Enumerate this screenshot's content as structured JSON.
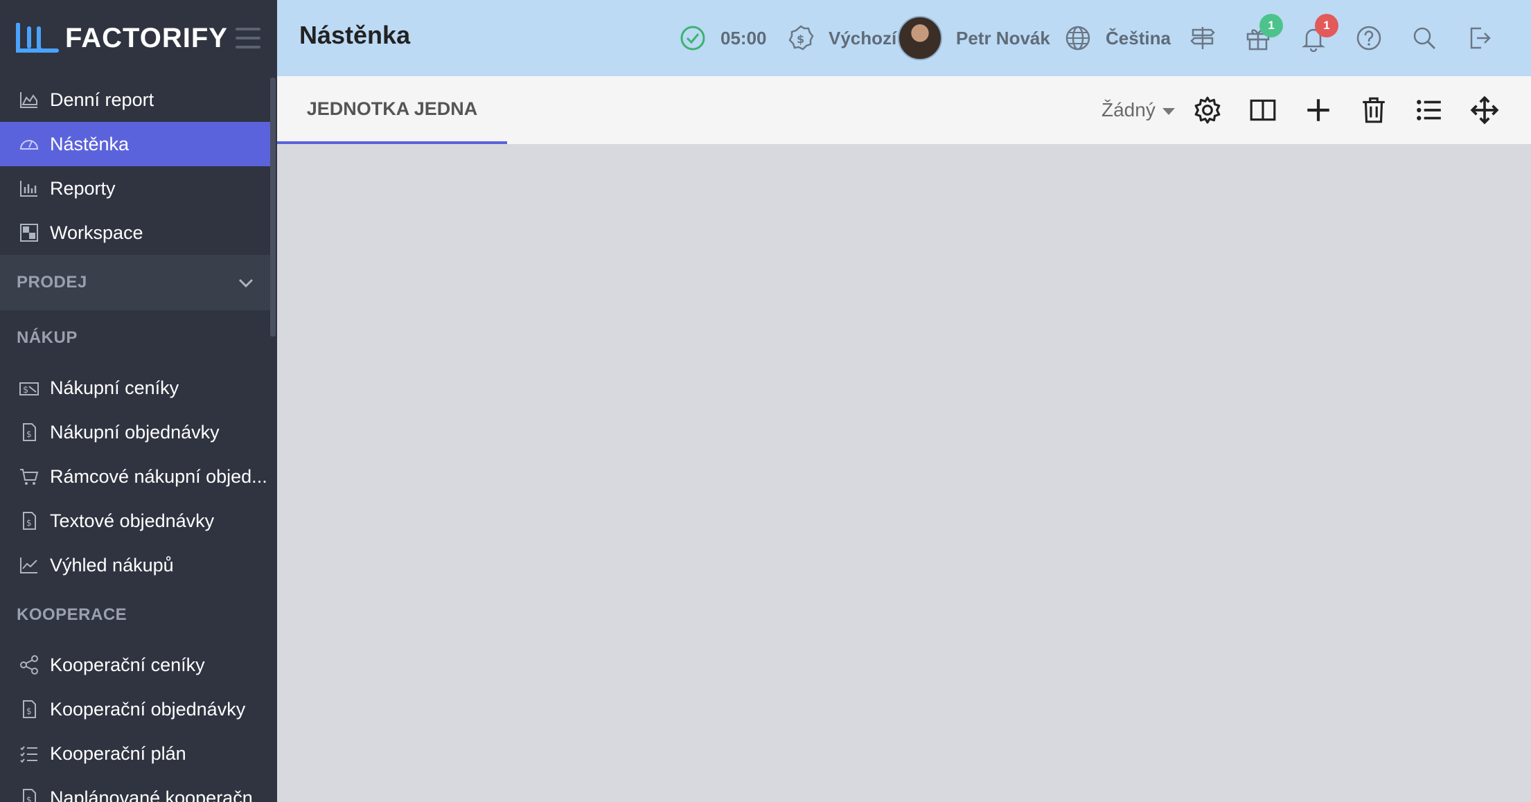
{
  "brand": {
    "name": "FACTORIFY"
  },
  "sidebar": {
    "top_items": [
      {
        "label": "Denní report",
        "icon": "area-chart-icon"
      },
      {
        "label": "Nástěnka",
        "icon": "dashboard-gauge-icon",
        "active": true
      },
      {
        "label": "Reporty",
        "icon": "bar-chart-icon"
      },
      {
        "label": "Workspace",
        "icon": "workspace-icon"
      }
    ],
    "sections": [
      {
        "title": "PRODEJ",
        "collapsible": true,
        "items": []
      },
      {
        "title": "NÁKUP",
        "items": [
          {
            "label": "Nákupní ceníky",
            "icon": "price-tag-icon"
          },
          {
            "label": "Nákupní objednávky",
            "icon": "invoice-icon"
          },
          {
            "label": "Rámcové nákupní objed...",
            "icon": "cart-icon"
          },
          {
            "label": "Textové objednávky",
            "icon": "invoice-icon"
          },
          {
            "label": "Výhled nákupů",
            "icon": "line-chart-icon"
          }
        ]
      },
      {
        "title": "KOOPERACE",
        "items": [
          {
            "label": "Kooperační ceníky",
            "icon": "share-icon"
          },
          {
            "label": "Kooperační objednávky",
            "icon": "invoice-icon"
          },
          {
            "label": "Kooperační plán",
            "icon": "checklist-icon"
          },
          {
            "label": "Naplánované kooperačn",
            "icon": "invoice-icon"
          }
        ]
      }
    ]
  },
  "header": {
    "title": "Nástěnka",
    "shift_time": "05:00",
    "currency": "Výchozí",
    "user_name": "Petr Novák",
    "language": "Čeština",
    "gifts_badge": "1",
    "notifications_badge": "1"
  },
  "tabs": [
    {
      "label": "JEDNOTKA JEDNA",
      "active": true
    }
  ],
  "toolbar": {
    "select_value": "Žádný"
  },
  "colors": {
    "accent": "#5b63dc",
    "sidebar": "#2f3440",
    "header": "#bcdaf4",
    "success": "#3cb371",
    "badge_green": "#4cc38a",
    "badge_red": "#e25a5a"
  }
}
